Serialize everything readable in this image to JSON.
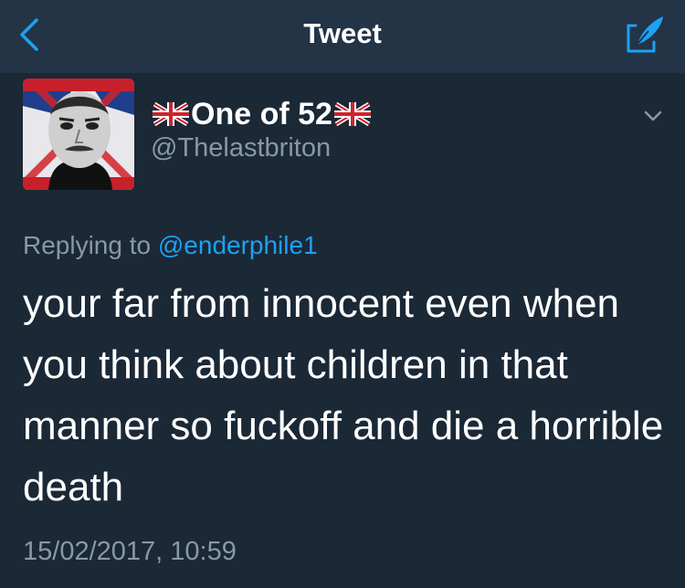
{
  "header": {
    "title": "Tweet",
    "back_icon": "chevron-left-icon",
    "compose_icon": "compose-tweet-icon",
    "accent_color": "#1da1f2",
    "background_color": "#243447"
  },
  "tweet": {
    "author": {
      "display_name": "One of 52",
      "handle": "@Thelastbriton",
      "name_prefix_icon": "uk-flag-icon",
      "name_suffix_icon": "uk-flag-icon"
    },
    "more_icon": "chevron-down-icon",
    "replying_to_label": "Replying to",
    "replying_to_handle": "@enderphile1",
    "text": "your far from innocent even when you think about children in that manner so fuckoff and die a horrible death",
    "timestamp": "15/02/2017, 10:59",
    "background_color": "#1b2836",
    "secondary_text_color": "#8899a6"
  }
}
